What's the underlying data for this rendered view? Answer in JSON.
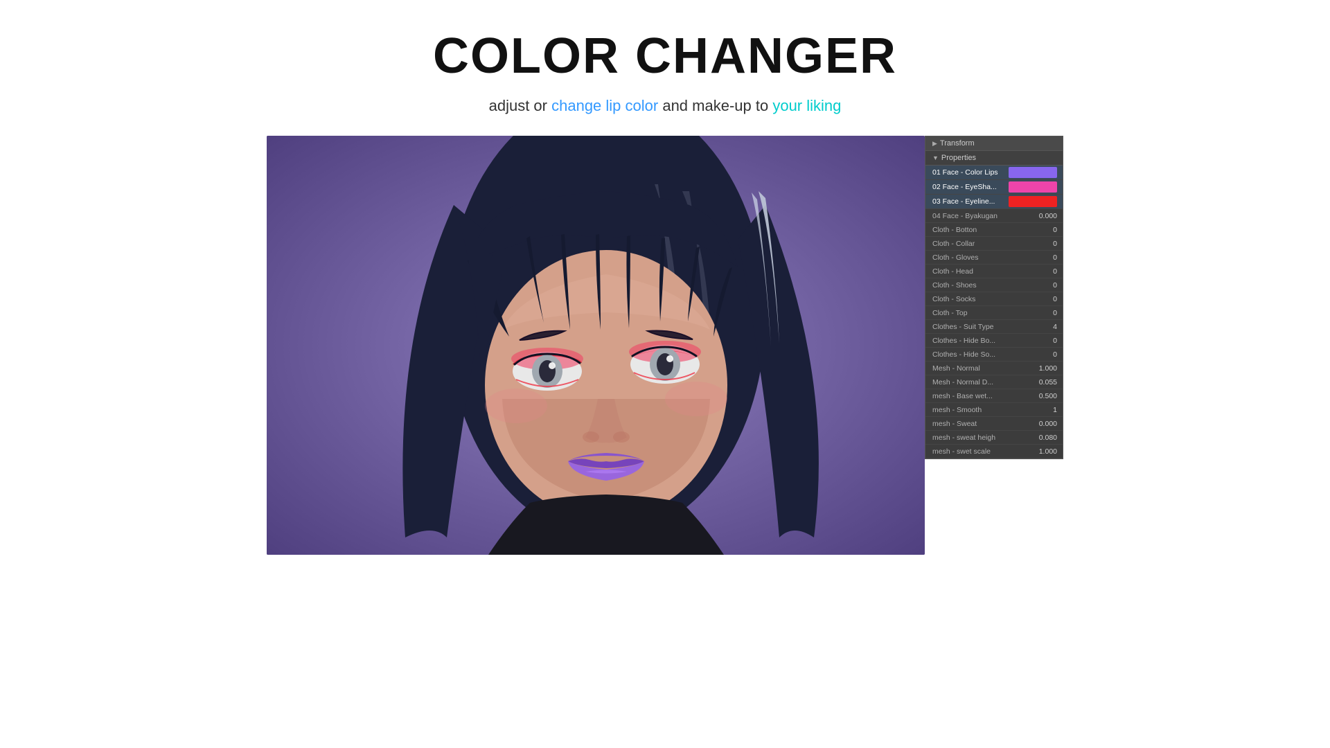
{
  "header": {
    "title": "COLOR CHANGER",
    "subtitle_plain": "adjust or ",
    "subtitle_link1": "change lip color",
    "subtitle_middle": " and make-up to ",
    "subtitle_link2": "your liking"
  },
  "viewport": {
    "corner_label": "▶"
  },
  "properties_panel": {
    "transform_label": "Transform",
    "properties_label": "Properties",
    "rows": [
      {
        "label": "01 Face - Color Lips",
        "type": "color",
        "color_class": "color-purple",
        "highlighted": true
      },
      {
        "label": "02 Face - EyeSha...",
        "type": "color",
        "color_class": "color-pink",
        "highlighted": true
      },
      {
        "label": "03 Face - Eyeline...",
        "type": "color",
        "color_class": "color-red",
        "highlighted": true
      },
      {
        "label": "04 Face - Byakugan",
        "type": "value",
        "value": "0.000"
      },
      {
        "label": "Cloth - Botton",
        "type": "value",
        "value": "0"
      },
      {
        "label": "Cloth - Collar",
        "type": "value",
        "value": "0"
      },
      {
        "label": "Cloth - Gloves",
        "type": "value",
        "value": "0"
      },
      {
        "label": "Cloth - Head",
        "type": "value",
        "value": "0"
      },
      {
        "label": "Cloth - Shoes",
        "type": "value",
        "value": "0"
      },
      {
        "label": "Cloth - Socks",
        "type": "value",
        "value": "0"
      },
      {
        "label": "Cloth - Top",
        "type": "value",
        "value": "0"
      },
      {
        "label": "Clothes - Suit Type",
        "type": "value",
        "value": "4"
      },
      {
        "label": "Clothes - Hide Bo...",
        "type": "value",
        "value": "0"
      },
      {
        "label": "Clothes - Hide So...",
        "type": "value",
        "value": "0"
      },
      {
        "label": "Mesh - Normal",
        "type": "value",
        "value": "1.000"
      },
      {
        "label": "Mesh - Normal D...",
        "type": "value",
        "value": "0.055"
      },
      {
        "label": "mesh - Base wet...",
        "type": "value",
        "value": "0.500"
      },
      {
        "label": "mesh - Smooth",
        "type": "value",
        "value": "1"
      },
      {
        "label": "mesh - Sweat",
        "type": "value",
        "value": "0.000"
      },
      {
        "label": "mesh - sweat heigh",
        "type": "value",
        "value": "0.080"
      },
      {
        "label": "mesh - swet scale",
        "type": "value",
        "value": "1.000"
      }
    ]
  }
}
